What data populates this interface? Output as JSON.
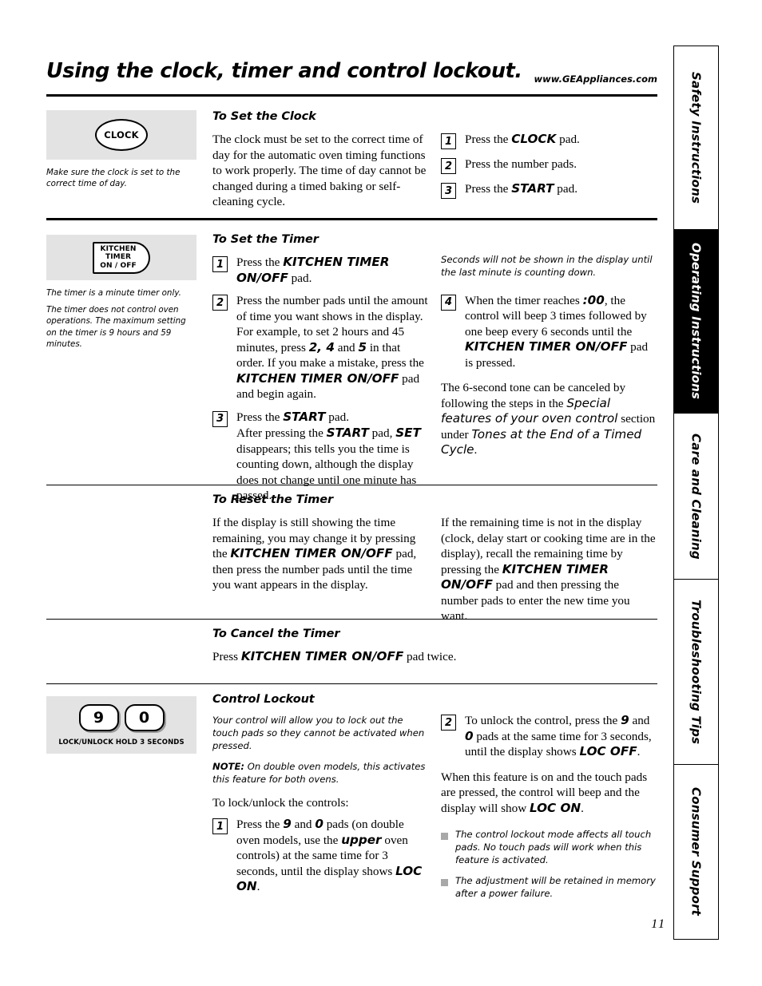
{
  "header": {
    "title": "Using the clock, timer and control lockout.",
    "url": "www.GEAppliances.com"
  },
  "page_number": "11",
  "sidebar": {
    "tabs": [
      {
        "label": "Safety Instructions",
        "active": false
      },
      {
        "label": "Operating Instructions",
        "active": true
      },
      {
        "label": "Care and Cleaning",
        "active": false
      },
      {
        "label": "Troubleshooting Tips",
        "active": false
      },
      {
        "label": "Consumer Support",
        "active": false
      }
    ]
  },
  "clock_section": {
    "pad_label": "CLOCK",
    "side_note": "Make sure the clock is set to the correct time of day.",
    "heading": "To Set the Clock",
    "body": "The clock must be set to the correct time of day for the automatic oven timing functions to work properly. The time of day cannot be changed during a timed baking or self-cleaning cycle.",
    "steps": [
      {
        "num": "1",
        "text_pre": "Press the ",
        "emph": "CLOCK",
        "text_post": " pad."
      },
      {
        "num": "2",
        "text_pre": "Press the number pads.",
        "emph": "",
        "text_post": ""
      },
      {
        "num": "3",
        "text_pre": "Press the ",
        "emph": "START",
        "text_post": " pad."
      }
    ]
  },
  "timer_section": {
    "pad_label_line1": "KITCHEN",
    "pad_label_line2": "TIMER",
    "pad_label_line3": "ON / OFF",
    "side_note_1": "The timer is a minute timer only.",
    "side_note_2": "The timer does not control oven operations. The maximum setting on the timer is 9 hours and 59 minutes.",
    "heading": "To Set the Timer",
    "step1": {
      "num": "1",
      "a": "Press the ",
      "b": "KITCHEN TIMER ON/OFF",
      "c": " pad."
    },
    "step2": {
      "num": "2",
      "a": "Press the number pads until the amount of time you want shows in the display. For example, to set 2 hours and 45 minutes, press ",
      "b": "2, 4",
      "c": " and ",
      "d": "5",
      "e": " in that order. If you make a mistake, press the ",
      "f": "KITCHEN TIMER ON/OFF",
      "g": " pad and begin again."
    },
    "step3": {
      "num": "3",
      "a": "Press the ",
      "b": "START",
      "c": " pad.",
      "note_a": "After pressing the ",
      "note_b": "START",
      "note_c": " pad, ",
      "note_d": "SET",
      "note_e": " disappears; this tells you the time is counting down, although the display does not change until one minute has passed."
    },
    "right_note": "Seconds will not be shown in the display until the last minute is counting down.",
    "step4": {
      "num": "4",
      "a": "When the timer reaches ",
      "b": ":00",
      "c": ", the control will beep 3 times followed by one beep every 6 seconds until the ",
      "d": "KITCHEN TIMER ON/OFF",
      "e": " pad is pressed."
    },
    "tone_note": {
      "a": "The 6-second tone can be canceled by following the steps in the ",
      "b": "Special features of your oven control",
      "c": " section under ",
      "d": "Tones at the End of a Timed Cycle",
      "e": "."
    }
  },
  "reset_section": {
    "heading": "To Reset the Timer",
    "left": {
      "a": "If the display is still showing the time remaining, you may change it by pressing the ",
      "b": "KITCHEN TIMER ON/OFF",
      "c": " pad, then press the number pads until the time you want appears in the display."
    },
    "right": {
      "a": "If the remaining time is not in the display (clock, delay start or cooking time are in the display), recall the remaining time by pressing the ",
      "b": "KITCHEN TIMER ON/OFF",
      "c": " pad and then pressing the number pads to enter the new time you want."
    }
  },
  "cancel_section": {
    "heading": "To Cancel the Timer",
    "a": "Press ",
    "b": "KITCHEN TIMER ON/OFF",
    "c": " pad twice."
  },
  "lockout_section": {
    "pad_9": "9",
    "pad_0": "0",
    "pad_caption": "LOCK/UNLOCK HOLD 3 SECONDS",
    "heading": "Control Lockout",
    "intro": "Your control will allow you to lock out the touch pads so they cannot be activated when pressed.",
    "note_label": "NOTE:",
    "note_text": " On double oven models, this activates this feature for both ovens.",
    "lead_in": "To lock/unlock the controls:",
    "step1": {
      "num": "1",
      "a": "Press the ",
      "b": "9",
      "c": " and ",
      "d": "0",
      "e": " pads (on double oven models, use the ",
      "f": "upper",
      "g": " oven controls) at the same time for 3 seconds, until the display shows ",
      "h": "LOC ON",
      "i": "."
    },
    "step2": {
      "num": "2",
      "a": "To unlock the control, press the ",
      "b": "9",
      "c": " and ",
      "d": "0",
      "e": " pads at the same time for 3 seconds, until the display shows ",
      "f": "LOC OFF",
      "g": "."
    },
    "after_note": {
      "a": "When this feature is on and the touch pads are pressed, the control will beep and the display will show ",
      "b": "LOC ON",
      "c": "."
    },
    "bullets": [
      "The control lockout mode affects all touch pads. No touch pads will work when this feature is activated.",
      "The adjustment will be retained in memory after a power failure."
    ]
  }
}
